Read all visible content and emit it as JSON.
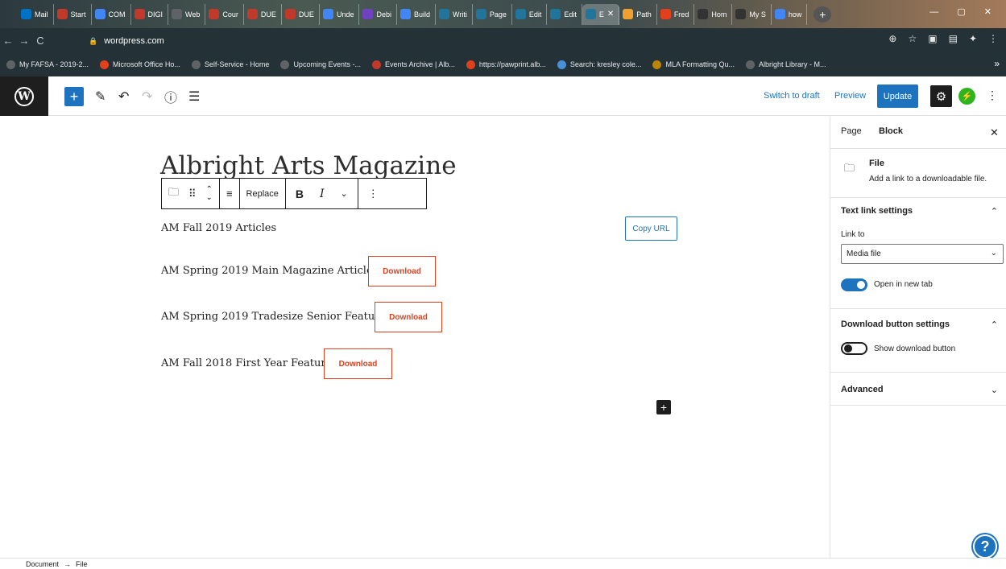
{
  "browser": {
    "tabs": [
      {
        "label": "Mail",
        "icon": "outlook-icon",
        "color": "#0072c6"
      },
      {
        "label": "Start",
        "icon": "albright-icon",
        "color": "#c0392b"
      },
      {
        "label": "COM",
        "icon": "docs-icon",
        "color": "#4285f4"
      },
      {
        "label": "DIGI",
        "icon": "albright-icon",
        "color": "#c0392b"
      },
      {
        "label": "Web",
        "icon": "globe-icon",
        "color": "#5f6368"
      },
      {
        "label": "Cour",
        "icon": "albright-icon",
        "color": "#c0392b"
      },
      {
        "label": "DUE",
        "icon": "albright-icon",
        "color": "#c0392b"
      },
      {
        "label": "DUE",
        "icon": "albright-icon",
        "color": "#c0392b"
      },
      {
        "label": "Unde",
        "icon": "google-icon",
        "color": "#4285f4"
      },
      {
        "label": "Debi",
        "icon": "d-icon",
        "color": "#6f42c1"
      },
      {
        "label": "Build",
        "icon": "google-icon",
        "color": "#4285f4"
      },
      {
        "label": "Writi",
        "icon": "wordpress-icon",
        "color": "#21759b"
      },
      {
        "label": "Page",
        "icon": "wordpress-icon",
        "color": "#21759b"
      },
      {
        "label": "Edit",
        "icon": "wordpress-icon",
        "color": "#21759b"
      },
      {
        "label": "Edit",
        "icon": "wordpress-icon",
        "color": "#21759b"
      },
      {
        "label": "E",
        "icon": "wordpress-icon",
        "color": "#21759b",
        "active": true
      },
      {
        "label": "Path",
        "icon": "path-icon",
        "color": "#f0a030"
      },
      {
        "label": "Fred",
        "icon": "fred-icon",
        "color": "#e2401c"
      },
      {
        "label": "Hom",
        "icon": "wix-icon",
        "color": "#333333"
      },
      {
        "label": "My S",
        "icon": "wix-icon",
        "color": "#333333"
      },
      {
        "label": "how",
        "icon": "google-icon",
        "color": "#4285f4"
      }
    ],
    "new_tab": "+",
    "url": "wordpress.com",
    "bookmarks": [
      {
        "label": "My FAFSA - 2019-2...",
        "color": "#5f6368"
      },
      {
        "label": "Microsoft Office Ho...",
        "color": "#e2401c"
      },
      {
        "label": "Self-Service - Home",
        "color": "#5f6368"
      },
      {
        "label": "Upcoming Events -...",
        "color": "#5f6368"
      },
      {
        "label": "Events Archive | Alb...",
        "color": "#c0392b"
      },
      {
        "label": "https://pawprint.alb...",
        "color": "#e2401c"
      },
      {
        "label": "Search: kresley cole...",
        "color": "#4a90d9"
      },
      {
        "label": "MLA Formatting Qu...",
        "color": "#b8860b"
      },
      {
        "label": "Albright Library - M...",
        "color": "#5f6368"
      }
    ]
  },
  "editor": {
    "header": {
      "switch_draft": "Switch to draft",
      "preview": "Preview",
      "update": "Update"
    },
    "title": "Albright Arts Magazine",
    "toolbar": {
      "replace": "Replace",
      "bold": "B",
      "italic": "I"
    },
    "copy_url": "Copy URL",
    "files": [
      {
        "name": "AM Fall 2019 Articles"
      },
      {
        "name": "AM Spring 2019 Main Magazine Articles",
        "button": "Download"
      },
      {
        "name": "AM Spring 2019 Tradesize Senior Feature",
        "button": "Download"
      },
      {
        "name": "AM Fall 2018 First Year Feature",
        "button": "Download"
      }
    ]
  },
  "sidebar": {
    "tabs": {
      "page": "Page",
      "block": "Block"
    },
    "block_title": "File",
    "block_desc": "Add a link to a downloadable file.",
    "text_link": {
      "heading": "Text link settings",
      "link_to_label": "Link to",
      "link_to_value": "Media file",
      "new_tab_label": "Open in new tab",
      "new_tab_on": true
    },
    "download_settings": {
      "heading": "Download button settings",
      "show_label": "Show download button",
      "show_on": false
    },
    "advanced": "Advanced"
  },
  "footer": {
    "crumb1": "Document",
    "arrow": "→",
    "crumb2": "File"
  }
}
